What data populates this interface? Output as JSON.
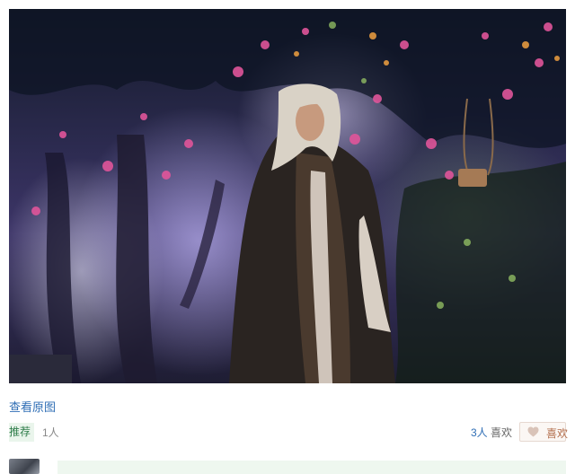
{
  "photo": {
    "alt": ""
  },
  "actions": {
    "view_original": "查看原图",
    "recommend_label": "推荐",
    "recommend_count": "1人",
    "likes_count": "3人",
    "likes_label": "喜欢",
    "like_button_label": "喜欢"
  },
  "icons": {
    "like": "heart-icon",
    "comment_avatar": "avatar"
  },
  "colors": {
    "link": "#2f6eb5",
    "recommend_bg": "#eaf5ec",
    "recommend_text": "#2f7d4a",
    "like_button_bg": "#fbf7f4",
    "like_text": "#b26c4a",
    "comment_strip_bg": "#eef7ef"
  }
}
